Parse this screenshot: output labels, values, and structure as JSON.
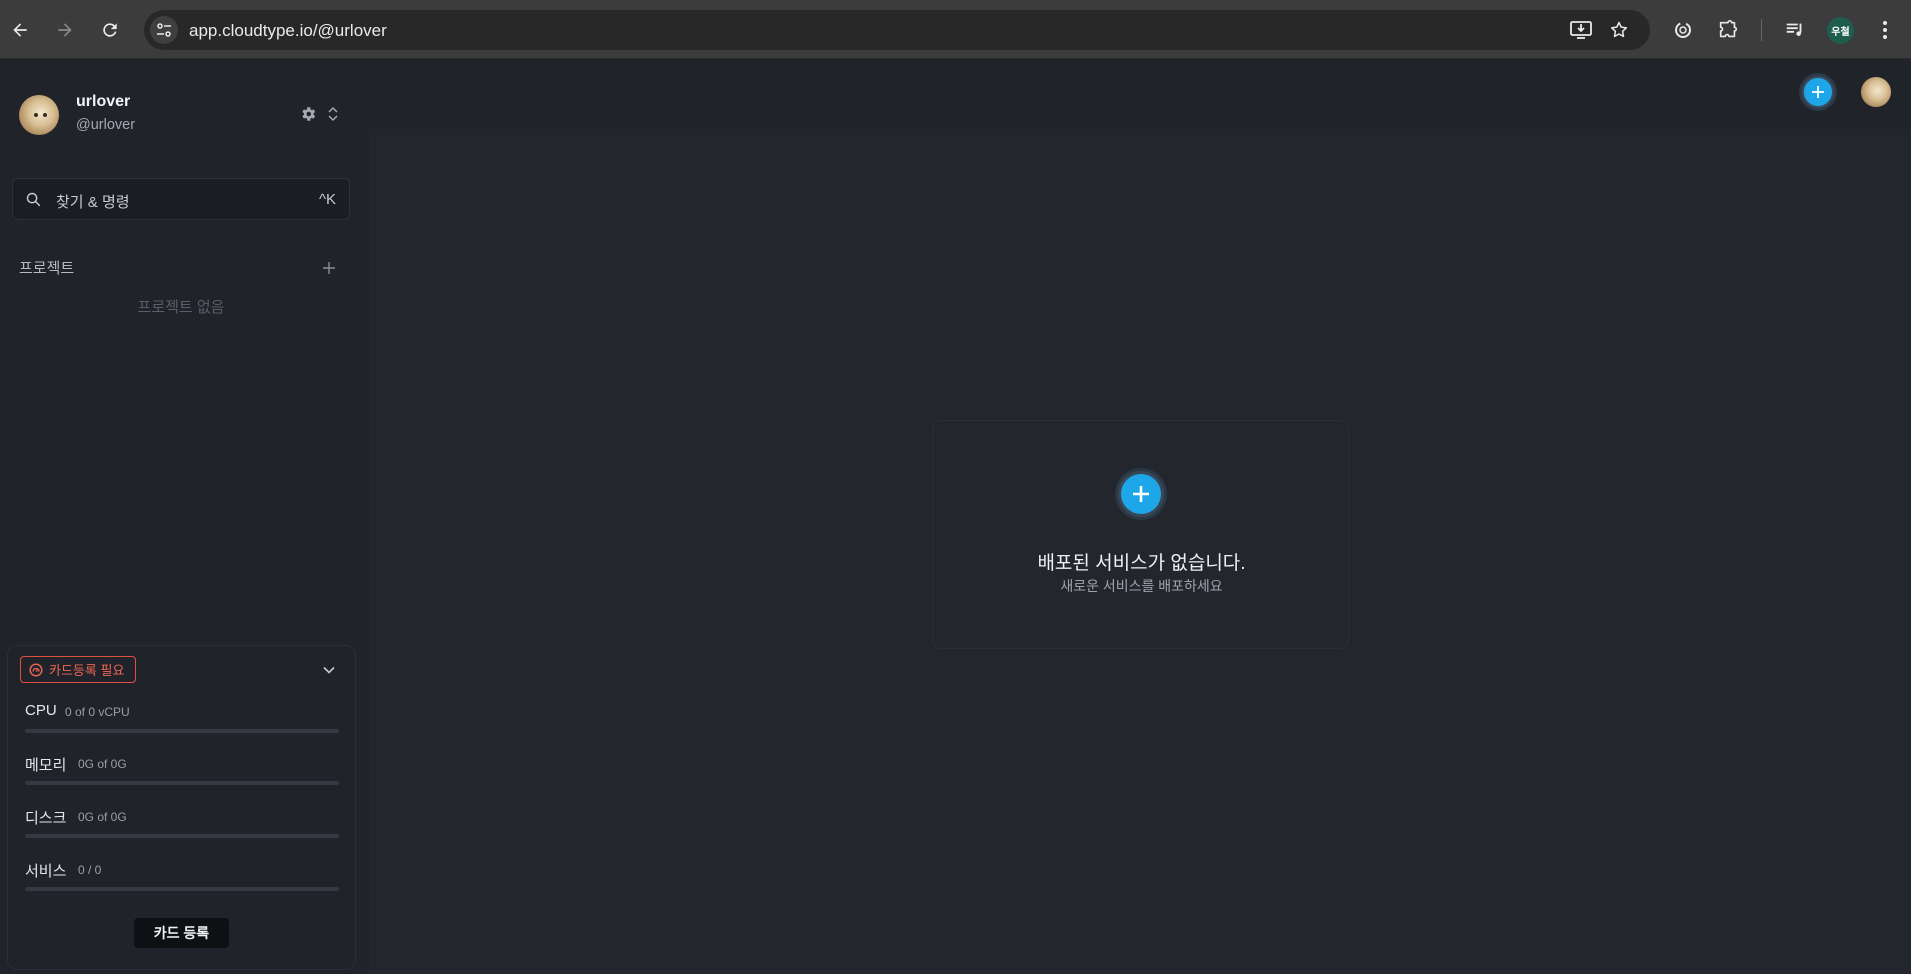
{
  "browser": {
    "url": "app.cloudtype.io/@urlover",
    "profile_initials": "우철"
  },
  "sidebar": {
    "user": {
      "name": "urlover",
      "handle": "@urlover"
    },
    "search": {
      "placeholder": "찾기 & 명령",
      "shortcut": "^K"
    },
    "projects": {
      "label": "프로젝트",
      "empty_text": "프로젝트 없음"
    },
    "usage": {
      "badge": "카드등록 필요",
      "rows": [
        {
          "label": "CPU",
          "value": "0 of 0 vCPU",
          "fill": 0
        },
        {
          "label": "메모리",
          "value": "0G of 0G",
          "fill": 0
        },
        {
          "label": "디스크",
          "value": "0G of 0G",
          "fill": 0
        },
        {
          "label": "서비스",
          "value": "0 / 0",
          "fill": 0
        }
      ],
      "register_button": "카드 등록"
    }
  },
  "main": {
    "empty_title": "배포된 서비스가 없습니다.",
    "empty_subtitle": "새로운 서비스를 배포하세요"
  },
  "colors": {
    "accent": "#1ea7e8",
    "warning": "#f06553",
    "background": "#20232a"
  },
  "icons": [
    "back-icon",
    "forward-icon",
    "reload-icon",
    "site-settings-icon",
    "install-app-icon",
    "bookmark-star-icon",
    "extension-sync-icon",
    "puzzle-icon",
    "media-list-icon",
    "more-vert-icon",
    "gear-icon",
    "chevron-updown-icon",
    "search-icon",
    "plus-icon",
    "warning-gauge-icon",
    "chevron-down-icon"
  ]
}
